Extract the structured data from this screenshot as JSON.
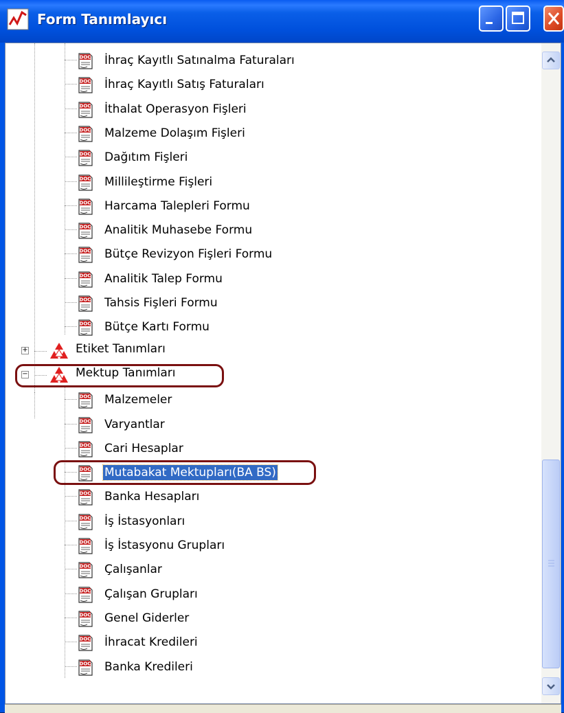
{
  "window": {
    "title": "Form Tanımlayıcı",
    "app_icon": "chart-line-icon",
    "controls": [
      "minimize-icon",
      "maximize-icon",
      "close-icon"
    ]
  },
  "tree": {
    "group_a_items": [
      "İhraç Kayıtlı Satınalma Faturaları",
      "İhraç Kayıtlı Satış Faturaları",
      "İthalat Operasyon Fişleri",
      "Malzeme Dolaşım Fişleri",
      "Dağıtım Fişleri",
      "Millileştirme Fişleri",
      "Harcama Talepleri Formu",
      "Analitik Muhasebe Formu",
      "Bütçe Revizyon Fişleri Formu",
      "Analitik Talep Formu",
      "Tahsis Fişleri Formu",
      "Bütçe Kartı Formu"
    ],
    "folder_collapsed": {
      "label": "Etiket Tanımları",
      "expander": "+"
    },
    "folder_expanded": {
      "label": "Mektup Tanımları",
      "expander": "−"
    },
    "group_b_items": [
      "Malzemeler",
      "Varyantlar",
      "Cari Hesaplar",
      "Mutabakat Mektupları(BA BS)",
      "Banka Hesapları",
      "İş İstasyonları",
      "İş İstasyonu Grupları",
      "Çalışanlar",
      "Çalışan Grupları",
      "Genel Giderler",
      "İhracat Kredileri",
      "Banka Kredileri"
    ],
    "selected_item": "Mutabakat Mektupları(BA BS)",
    "doc_icon_text": "DOC"
  },
  "colors": {
    "titlebar": "#0055e5",
    "selection": "#316ac5",
    "highlight_ring": "#7a1010",
    "folder_icon": "#e02020"
  }
}
